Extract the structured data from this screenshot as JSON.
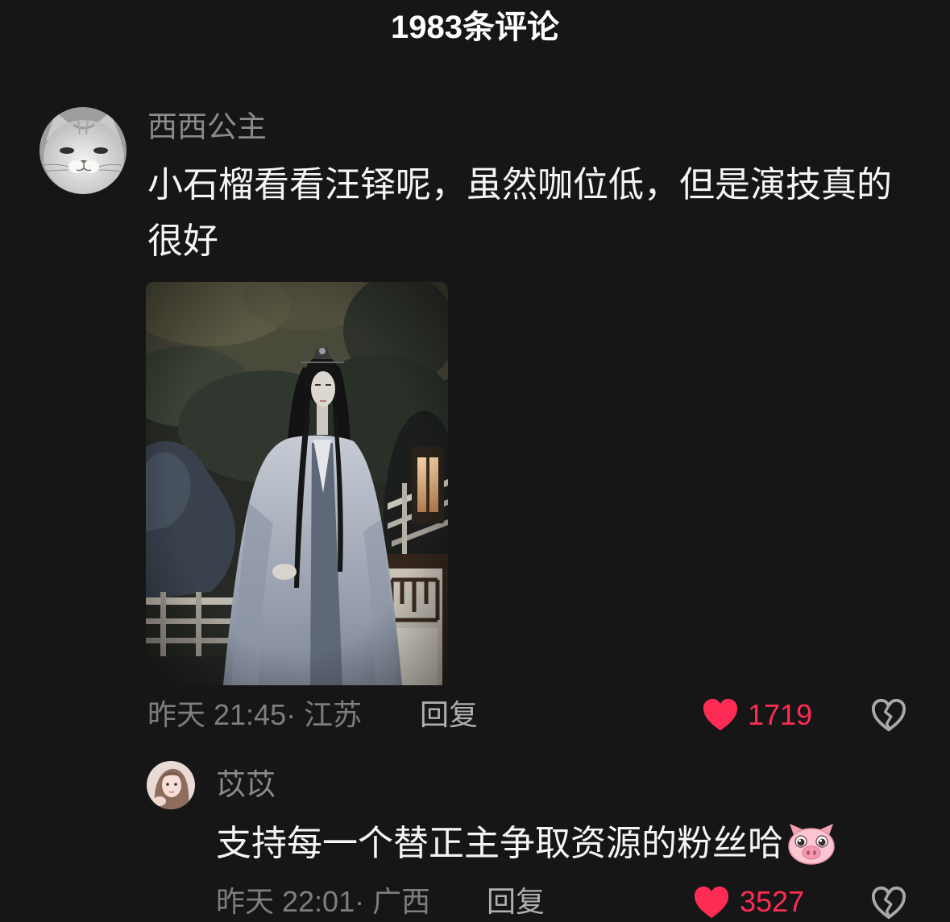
{
  "header": {
    "title": "1983条评论"
  },
  "comments": [
    {
      "username": "西西公主",
      "text": "小石榴看看汪铎呢，虽然咖位低，但是演技真的很好",
      "has_image": true,
      "meta": "昨天 21:45· 江苏",
      "reply_label": "回复",
      "likes": "1719",
      "liked": true,
      "like_icon": "heart-icon",
      "dislike_icon": "broken-heart-icon",
      "replies": [
        {
          "username": "苡苡",
          "text": "支持每一个替正主争取资源的粉丝哈",
          "emoji": "pig-face-emoji",
          "meta": "昨天 22:01· 广西",
          "reply_label": "回复",
          "likes": "3527",
          "liked": true,
          "like_icon": "heart-icon",
          "dislike_icon": "broken-heart-icon"
        }
      ]
    }
  ],
  "colors": {
    "background": "#161616",
    "title": "#ffffff",
    "text": "#f5f5f5",
    "username": "#8a8a8a",
    "meta": "#7e7e7e",
    "reply": "#b0b0b0",
    "like": "#fe2c55",
    "dislike_icon": "#a8a8a8"
  }
}
